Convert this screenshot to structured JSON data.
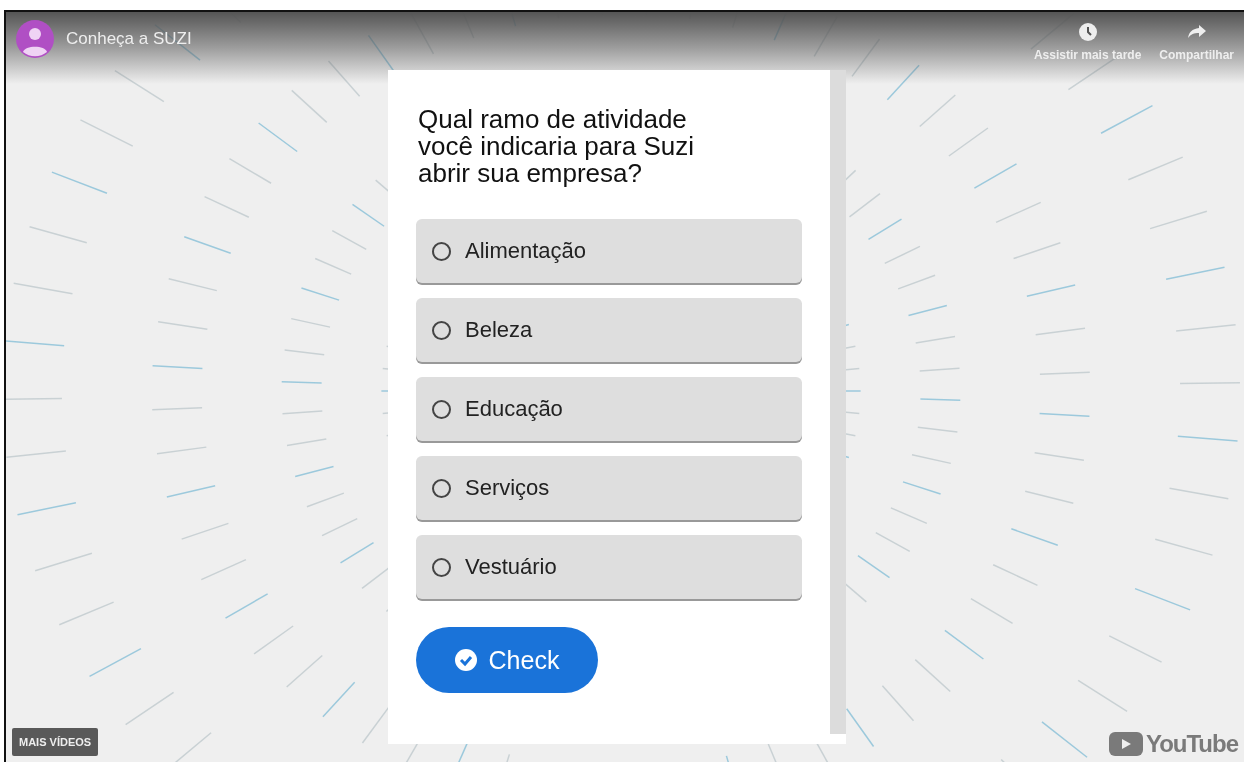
{
  "video": {
    "title": "Conheça a SUZI",
    "actions": [
      {
        "kind": "clock",
        "label": "Assistir mais tarde"
      },
      {
        "kind": "share",
        "label": "Compartilhar"
      }
    ],
    "more_videos": "MAIS VÍDEOS",
    "logo": "YouTube"
  },
  "quiz": {
    "question": "Qual ramo de atividade você indicaria para Suzi abrir sua empresa?",
    "options": [
      {
        "label": "Alimentação",
        "selected": false
      },
      {
        "label": "Beleza",
        "selected": false
      },
      {
        "label": "Educação",
        "selected": false
      },
      {
        "label": "Serviços",
        "selected": false
      },
      {
        "label": "Vestuário",
        "selected": false
      }
    ],
    "check_button": "Check"
  }
}
